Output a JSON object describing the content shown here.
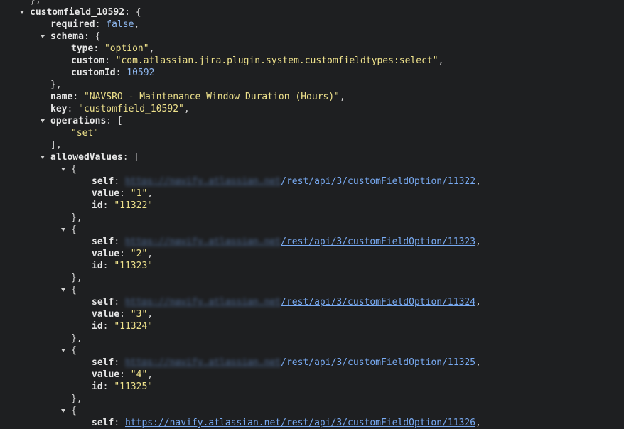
{
  "root_key": "customfield_10592",
  "required": {
    "key": "required",
    "value": "false"
  },
  "schema": {
    "key": "schema",
    "type": {
      "key": "type",
      "value": "\"option\""
    },
    "custom": {
      "key": "custom",
      "value": "\"com.atlassian.jira.plugin.system.customfieldtypes:select\""
    },
    "customId": {
      "key": "customId",
      "value": "10592"
    }
  },
  "name": {
    "key": "name",
    "value": "\"NAVSRO - Maintenance Window Duration (Hours)\""
  },
  "key": {
    "key": "key",
    "value": "\"customfield_10592\""
  },
  "operations": {
    "key": "operations",
    "items": [
      "\"set\""
    ]
  },
  "allowedValues": {
    "key": "allowedValues",
    "items": [
      {
        "self_host": "https://navify.atlassian.net",
        "self_path": "/rest/api/3/customFieldOption/11322",
        "value": "\"1\"",
        "id": "\"11322\""
      },
      {
        "self_host": "https://navify.atlassian.net",
        "self_path": "/rest/api/3/customFieldOption/11323",
        "value": "\"2\"",
        "id": "\"11323\""
      },
      {
        "self_host": "https://navify.atlassian.net",
        "self_path": "/rest/api/3/customFieldOption/11324",
        "value": "\"3\"",
        "id": "\"11324\""
      },
      {
        "self_host": "https://navify.atlassian.net",
        "self_path": "/rest/api/3/customFieldOption/11325",
        "value": "\"4\"",
        "id": "\"11325\""
      }
    ],
    "partial_last": {
      "self_url": "https://navify.atlassian.net/rest/api/3/customFieldOption/11326"
    }
  },
  "labels": {
    "self": "self",
    "value": "value",
    "id": "id"
  },
  "colors": {
    "background": "#1e1f21",
    "key": "#e6e6e6",
    "string": "#eee18b",
    "number": "#8fb8f0",
    "link": "#78aaf2"
  }
}
